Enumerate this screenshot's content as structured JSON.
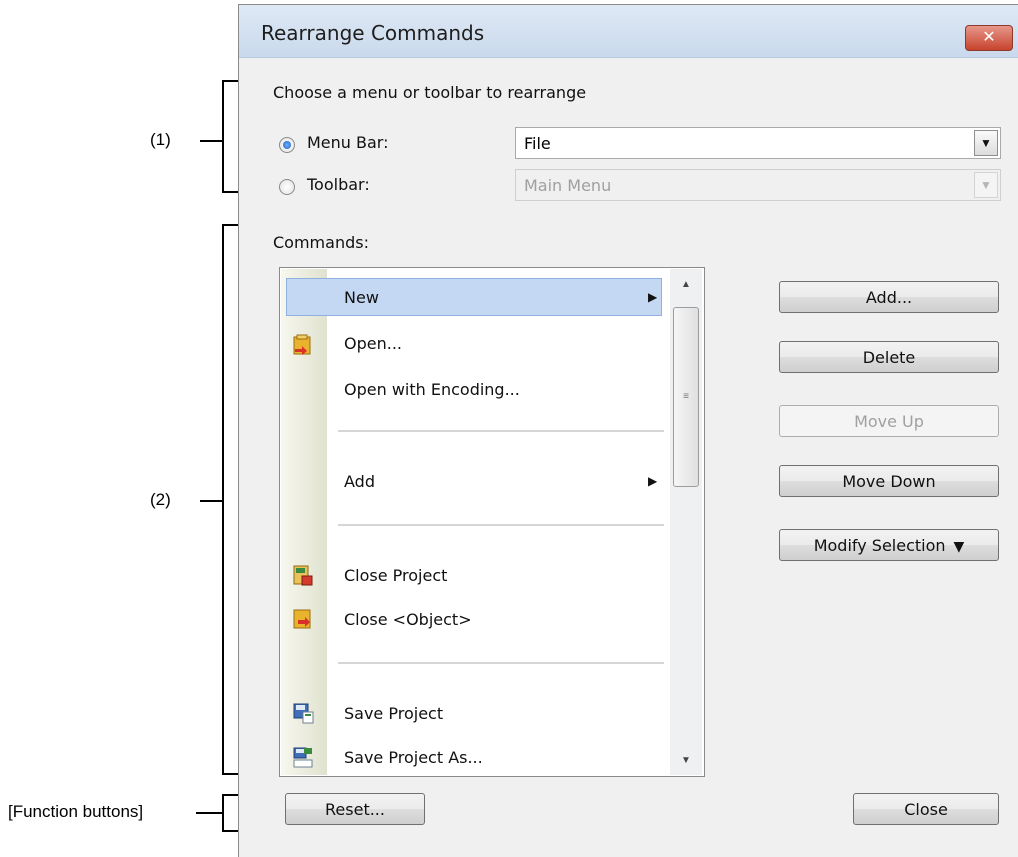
{
  "annotations": {
    "label_1": "(1)",
    "label_2": "(2)",
    "label_function": "[Function buttons]"
  },
  "dialog": {
    "title": "Rearrange Commands",
    "close_glyph": "✕",
    "choose_label": "Choose a menu or toolbar to rearrange",
    "menu_bar_label": "Menu Bar:",
    "menu_bar_checked": true,
    "menu_bar_value": "File",
    "toolbar_label": "Toolbar:",
    "toolbar_value": "Main Menu",
    "commands_label": "Commands:"
  },
  "commands": [
    {
      "label": "New",
      "submenu": true,
      "selected": true,
      "icon": null
    },
    {
      "label": "Open...",
      "icon": "open-folder-icon"
    },
    {
      "label": "Open with Encoding...",
      "icon": null
    },
    {
      "label": "Add",
      "submenu": true,
      "icon": null
    },
    {
      "label": "Close Project",
      "icon": "close-project-icon"
    },
    {
      "label": "Close <Object>",
      "icon": "close-object-icon"
    },
    {
      "label": "Save Project",
      "icon": "save-project-icon"
    },
    {
      "label": "Save Project As...",
      "icon": "save-project-as-icon"
    }
  ],
  "buttons": {
    "add": "Add...",
    "delete": "Delete",
    "move_up": "Move Up",
    "move_down": "Move Down",
    "modify_selection": "Modify Selection",
    "reset": "Reset...",
    "close": "Close"
  },
  "icons": {
    "dropdown": "▼",
    "submenu": "▶",
    "scroll_up": "▲",
    "scroll_down": "▼",
    "scroll_grip": "≡"
  }
}
